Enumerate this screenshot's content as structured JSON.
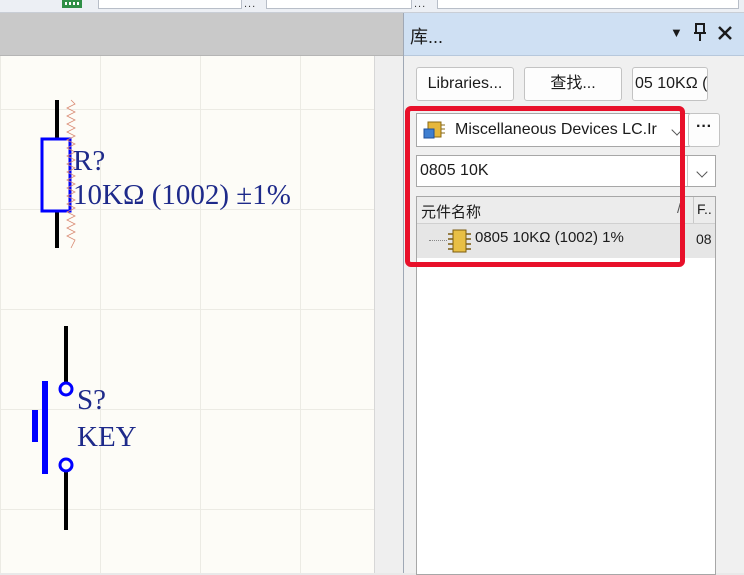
{
  "toolbar": {
    "icon": "component-chip-icon",
    "overflow_glyph": "..."
  },
  "schematic": {
    "resistor": {
      "designator": "R?",
      "comment": "10KΩ (1002) ±1%"
    },
    "switch": {
      "designator": "S?",
      "comment": "KEY"
    }
  },
  "panel": {
    "title": "库...",
    "pin_glyph": "▼",
    "buttons": {
      "libraries": "Libraries...",
      "search": "查找...",
      "place": "05 10KΩ ("
    },
    "library_select": {
      "value": "Miscellaneous Devices LC.Ir",
      "icon": "library-icon"
    },
    "more_button": "···",
    "filter": {
      "value": "0805 10K"
    },
    "columns": [
      {
        "label": "元件名称"
      },
      {
        "label": "F.."
      }
    ],
    "components": [
      {
        "name": "0805 10KΩ (1002) 1%",
        "footprint": "08",
        "icon": "chip-icon"
      }
    ]
  },
  "colors": {
    "accent": "#1e2a8a",
    "wire": "#0000ff",
    "highlight": "#e8102a",
    "panel_header": "#cfe0f3"
  }
}
